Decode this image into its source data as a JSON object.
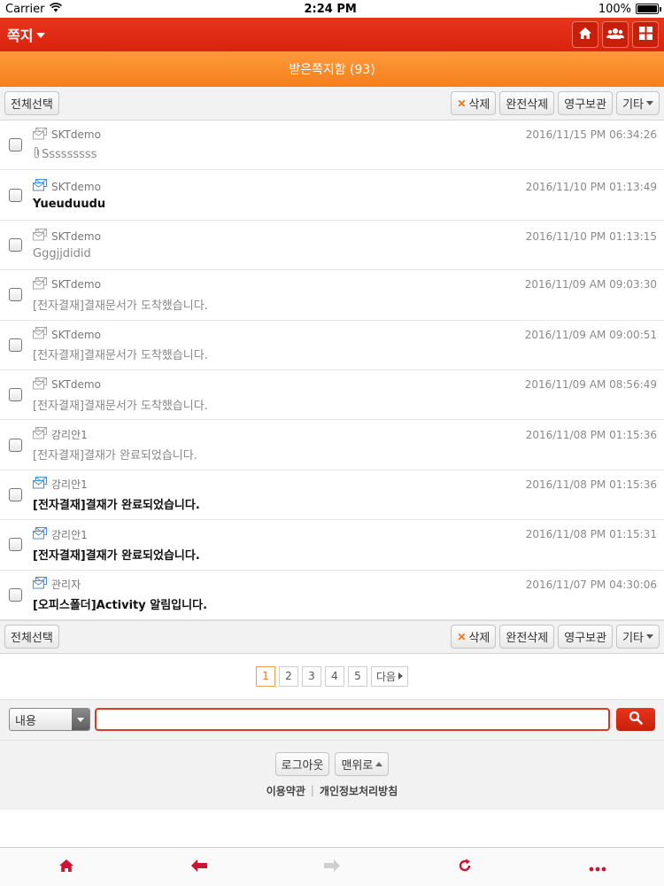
{
  "status_bar": {
    "carrier": "Carrier",
    "time": "2:24 PM",
    "battery": "100%"
  },
  "header": {
    "title": "쪽지"
  },
  "subheader": {
    "title": "받은쪽지함 (93)"
  },
  "toolbar": {
    "select_all": "전체선택",
    "delete": "삭제",
    "permanent_delete": "완전삭제",
    "archive": "영구보관",
    "more": "기타"
  },
  "messages": [
    {
      "sender": "SKTdemo",
      "date": "2016/11/15 PM 06:34:26",
      "subject": "Sssssssss",
      "read": true,
      "attachment": true
    },
    {
      "sender": "SKTdemo",
      "date": "2016/11/10 PM 01:13:49",
      "subject": "Yueuduudu",
      "read": false,
      "attachment": false
    },
    {
      "sender": "SKTdemo",
      "date": "2016/11/10 PM 01:13:15",
      "subject": "Gggjjdidid",
      "read": true,
      "attachment": false
    },
    {
      "sender": "SKTdemo",
      "date": "2016/11/09 AM 09:03:30",
      "subject": "[전자결재]결재문서가 도착했습니다.",
      "read": true,
      "attachment": false
    },
    {
      "sender": "SKTdemo",
      "date": "2016/11/09 AM 09:00:51",
      "subject": "[전자결재]결재문서가 도착했습니다.",
      "read": true,
      "attachment": false
    },
    {
      "sender": "SKTdemo",
      "date": "2016/11/09 AM 08:56:49",
      "subject": "[전자결재]결재문서가 도착했습니다.",
      "read": true,
      "attachment": false
    },
    {
      "sender": "강리안1",
      "date": "2016/11/08 PM 01:15:36",
      "subject": "[전자결재]결재가 완료되었습니다.",
      "read": true,
      "attachment": false
    },
    {
      "sender": "강리안1",
      "date": "2016/11/08 PM 01:15:36",
      "subject": "[전자결재]결재가 완료되었습니다.",
      "read": false,
      "attachment": false
    },
    {
      "sender": "강리안1",
      "date": "2016/11/08 PM 01:15:31",
      "subject": "[전자결재]결재가 완료되었습니다.",
      "read": false,
      "attachment": false
    },
    {
      "sender": "관리자",
      "date": "2016/11/07 PM 04:30:06",
      "subject": "[오피스폴더]Activity 알림입니다.",
      "read": false,
      "attachment": false
    }
  ],
  "pagination": {
    "pages": [
      "1",
      "2",
      "3",
      "4",
      "5"
    ],
    "current": "1",
    "next": "다음"
  },
  "search": {
    "field": "내용",
    "value": ""
  },
  "footer": {
    "logout": "로그아웃",
    "top": "맨위로",
    "terms": "이용약관",
    "privacy": "개인정보처리방침"
  },
  "colors": {
    "header_red": "#e8341c",
    "subheader_orange": "#f47f1b",
    "accent_red": "#cc1533"
  },
  "icons": {
    "header": [
      "home-icon",
      "users-icon",
      "grid-icon"
    ],
    "bottom_bar": [
      "home-icon",
      "back-arrow-icon",
      "forward-arrow-icon",
      "refresh-icon",
      "more-icon"
    ]
  }
}
